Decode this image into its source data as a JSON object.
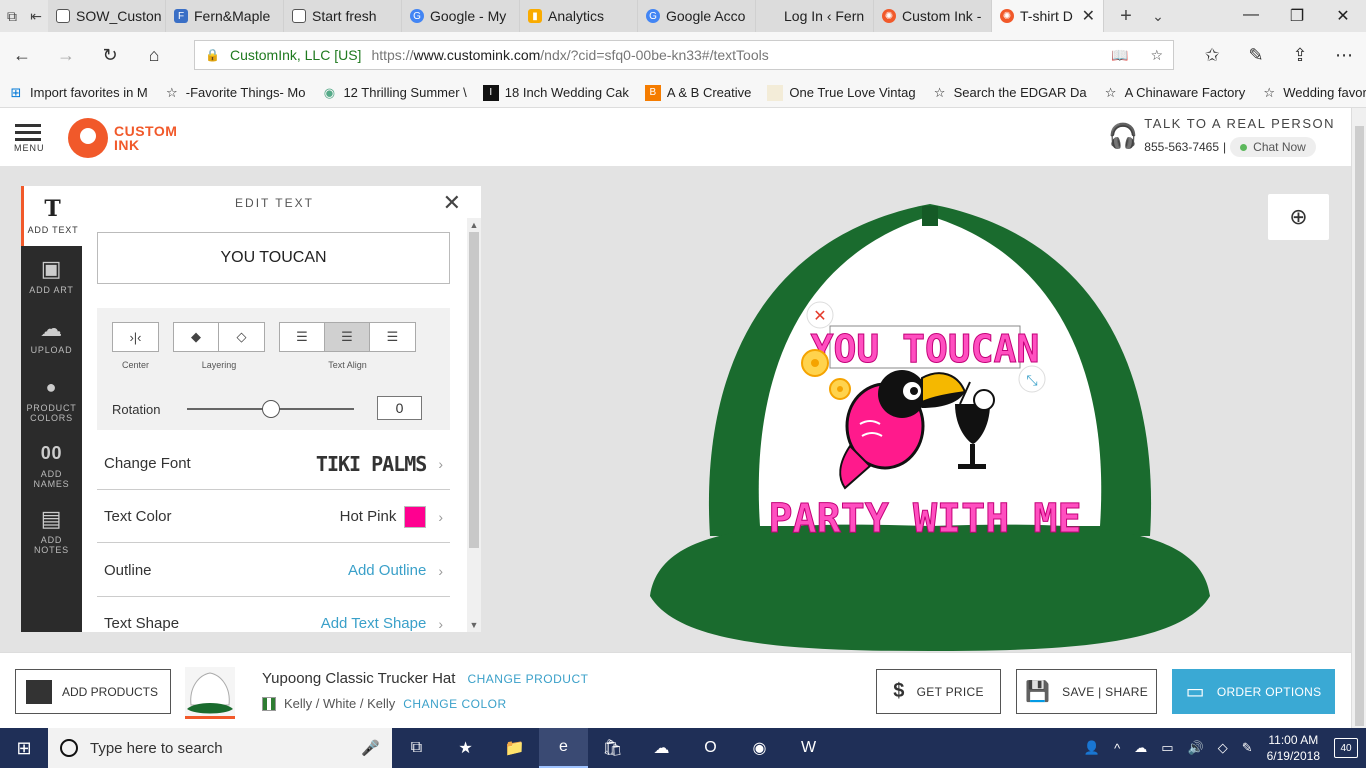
{
  "browser": {
    "tabs": [
      {
        "label": "SOW_Custon",
        "icon": "page-icon",
        "active": false
      },
      {
        "label": "Fern&Maple",
        "icon": "fern-maple-icon",
        "active": false
      },
      {
        "label": "Start fresh",
        "icon": "page-icon",
        "active": false
      },
      {
        "label": "Google - My",
        "icon": "google-icon",
        "active": false
      },
      {
        "label": "Analytics",
        "icon": "analytics-icon",
        "active": false
      },
      {
        "label": "Google Acco",
        "icon": "google-icon",
        "active": false
      },
      {
        "label": "Log In ‹ Fern",
        "icon": "page-icon",
        "active": false
      },
      {
        "label": "Custom Ink -",
        "icon": "customink-icon",
        "active": false
      },
      {
        "label": "T-shirt D",
        "icon": "customink-icon",
        "active": true
      }
    ],
    "address": {
      "org": "CustomInk, LLC [US]",
      "url_prefix": "https://",
      "url_domain": "www.customink.com",
      "url_path": "/ndx/?cid=sfq0-00be-kn33#/textTools"
    },
    "favorites": [
      "Import favorites in M",
      "-Favorite Things- Mo",
      "12 Thrilling Summer \\",
      "18 Inch Wedding Cak",
      "A & B Creative",
      "One True Love Vintag",
      "Search the EDGAR Da",
      "A Chinaware Factory",
      "Wedding favors, Wed"
    ]
  },
  "header": {
    "menu_label": "MENU",
    "logo_line1": "CUSTOM",
    "logo_line2": "INK",
    "talk_title": "TALK TO A REAL PERSON",
    "phone": "855-563-7465",
    "chat_label": "Chat Now"
  },
  "rail": {
    "items": [
      {
        "label": "ADD TEXT",
        "icon": "T"
      },
      {
        "label": "ADD ART",
        "icon": "▣"
      },
      {
        "label": "UPLOAD",
        "icon": "☁"
      },
      {
        "label": "PRODUCT COLORS",
        "icon": "💧"
      },
      {
        "label": "ADD NAMES",
        "icon": "00"
      },
      {
        "label": "ADD NOTES",
        "icon": "▤"
      }
    ]
  },
  "edit_text": {
    "title": "EDIT TEXT",
    "text_value": "YOU TOUCAN",
    "center_label": "Center",
    "layering_label": "Layering",
    "align_label": "Text Align",
    "rotation_label": "Rotation",
    "rotation_value": "0",
    "rotation_fraction": 0.5,
    "font_label": "Change Font",
    "font_value": "TIKI PALMS",
    "color_label": "Text Color",
    "color_value": "Hot Pink",
    "color_hex": "#ff0090",
    "outline_label": "Outline",
    "outline_value": "Add Outline",
    "shape_label": "Text Shape",
    "shape_value": "Add Text Shape"
  },
  "design": {
    "line1": "YOU TOUCAN",
    "line2": "PARTY WITH ME",
    "text_color": "#ff4fc0",
    "hat_green": "#1a6b2e"
  },
  "product": {
    "add_products_label": "ADD PRODUCTS",
    "name": "Yupoong Classic Trucker Hat",
    "change_product": "CHANGE PRODUCT",
    "color_text": "Kelly / White / Kelly",
    "change_color": "CHANGE COLOR",
    "get_price": "GET PRICE",
    "save_share": "SAVE | SHARE",
    "order_options": "ORDER OPTIONS"
  },
  "taskbar": {
    "search_placeholder": "Type here to search",
    "time": "11:00 AM",
    "date": "6/19/2018",
    "notifications": "40"
  }
}
